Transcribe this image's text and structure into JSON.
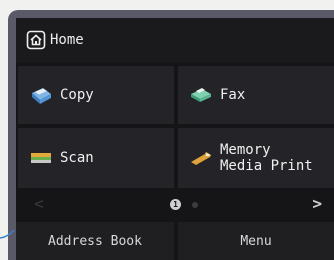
{
  "header": {
    "title": "Home",
    "icon": "home-icon"
  },
  "tiles": [
    {
      "label": "Copy",
      "icon": "copy-icon"
    },
    {
      "label": "Fax",
      "icon": "fax-icon"
    },
    {
      "label": "Scan",
      "icon": "scan-icon"
    },
    {
      "label": "Memory\nMedia Print",
      "icon": "memory-media-print-icon"
    }
  ],
  "pager": {
    "prev": "<",
    "next": ">",
    "page_indicator": "1"
  },
  "bottom": {
    "address_book": "Address Book",
    "menu": "Menu"
  },
  "colors": {
    "bezel": "#5a5968",
    "screen": "#151517",
    "tile": "#242428"
  }
}
